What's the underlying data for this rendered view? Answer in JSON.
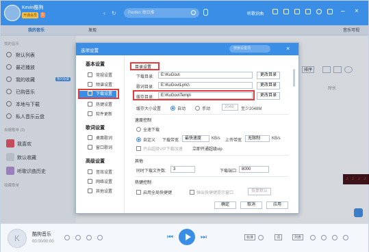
{
  "titlebar": {
    "username": "Kevin酷狗",
    "vip_badge": "开通会员",
    "vip_badge2": "1",
    "search_placeholder": "Panfen 每日推",
    "right_text": "听歌识曲",
    "win_min": "–",
    "win_close": "×"
  },
  "tabs": {
    "my_music": "我的音乐",
    "discover": "发现",
    "right_tab": "音乐可视"
  },
  "sidebar": {
    "section_my": "我的音乐",
    "items": [
      {
        "label": "默认列表"
      },
      {
        "label": "最近播放"
      },
      {
        "label": "我的收藏"
      },
      {
        "label": "已购音乐"
      },
      {
        "label": "本地与下载"
      },
      {
        "label": "私人音乐云盘"
      }
    ],
    "collect_badge": "我的收藏",
    "section_playlists": "自建歌单 (3)",
    "playlists": [
      {
        "label": "我喜欢"
      },
      {
        "label": "默认收藏"
      },
      {
        "label": "听歌识曲历史"
      }
    ],
    "section_collected": "收藏歌单"
  },
  "content": {
    "sort_label": "排序",
    "col_time": "时长",
    "lyric_text": "♪ ♪ ♪ ♪"
  },
  "dialog": {
    "title": "选项设置",
    "search_placeholder": "搜索设置项",
    "close": "×",
    "nav": {
      "basic_group": "基本设置",
      "basic_items": [
        "常规设置",
        "频谱设置",
        "下载设置",
        "热键设置",
        "软件更新"
      ],
      "lyrics_group": "歌词设置",
      "lyrics_items": [
        "桌面歌词",
        "窗口歌词"
      ],
      "advanced_group": "高级设置",
      "advanced_items": [
        "音效设置",
        "网络设置",
        "其他设置"
      ]
    },
    "dir": {
      "section": "目录设置",
      "download_label": "下载目录:",
      "download_value": "E:\\KuGou\\",
      "lyrics_label": "歌词目录:",
      "lyrics_value": "E:\\KuGou\\Lyric\\",
      "cache_label": "缓存目录:",
      "cache_value": "E:\\KuGou\\Temp\\",
      "change_btn": "更改目录"
    },
    "cache_size": {
      "label": "缓存大小设置",
      "auto": "自动",
      "manual": "手动",
      "value": "2048",
      "hint": "至少2048M"
    },
    "speed": {
      "section": "速度控制",
      "full": "全速下载",
      "custom": "自定义",
      "down_label": "下载带宽",
      "down_value": "最快速度",
      "unit": "KB/s",
      "up_label": "上传带宽",
      "up_value": "无限制",
      "vip_check": "开启超级VIP下载加速",
      "vip_link": "立即开通超级vip"
    },
    "other": {
      "section": "其他",
      "count_label": "同时下载文件数:",
      "count_value": "3",
      "port_label": "下载端口:",
      "port_value": "8000"
    },
    "hotkey": {
      "section": "热键控制",
      "global_check": "启用全局快捷键",
      "conflict_check": "弹出快捷键提示窗口",
      "restore_btn": "恢复默认"
    },
    "footer": {
      "ok": "确定",
      "cancel": "取消",
      "apply": "应用"
    }
  },
  "player": {
    "title": "酷狗音乐",
    "time": "00:00/00:00",
    "quality": "标准",
    "lyric_btn": "词",
    "playlist_btn": "列表"
  },
  "colors": {
    "accent": "#3a8ee6",
    "highlight_red": "#e43a3a"
  }
}
